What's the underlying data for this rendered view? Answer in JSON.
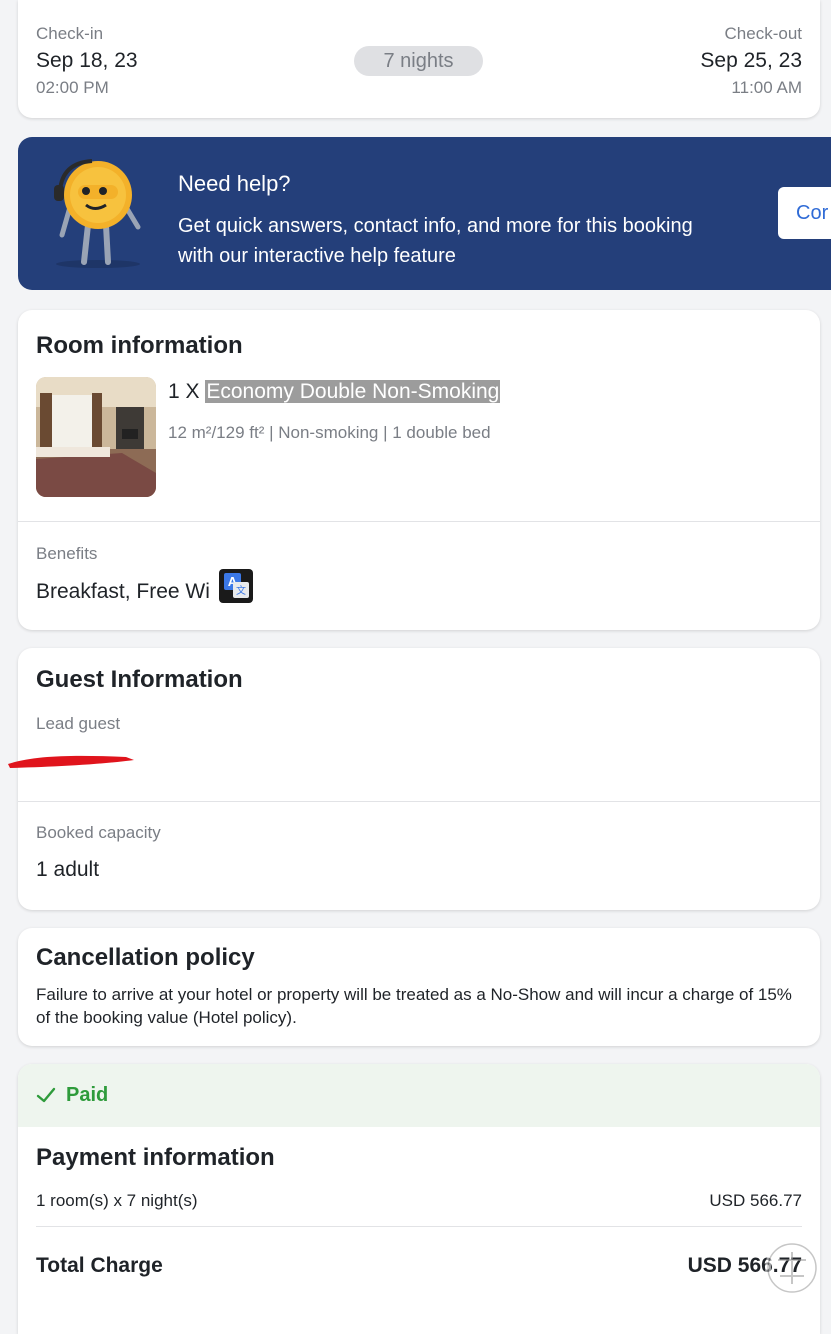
{
  "stay": {
    "checkin_label": "Check-in",
    "checkin_date": "Sep 18, 23",
    "checkin_time": "02:00 PM",
    "nights": "7 nights",
    "checkout_label": "Check-out",
    "checkout_date": "Sep 25, 23",
    "checkout_time": "11:00 AM"
  },
  "help": {
    "title": "Need help?",
    "text": "Get quick answers, contact info, and more for this booking with our interactive help feature",
    "button": "Cor"
  },
  "room": {
    "section_title": "Room information",
    "qty": "1 X",
    "name": "Economy Double Non-Smoking",
    "meta": "12 m²/129 ft² | Non-smoking | 1 double bed",
    "benefits_label": "Benefits",
    "benefits_value": "Breakfast, Free Wi"
  },
  "guest": {
    "section_title": "Guest Information",
    "lead_label": "Lead guest",
    "capacity_label": "Booked capacity",
    "capacity_value": "1 adult"
  },
  "cancellation": {
    "title": "Cancellation policy",
    "text": "Failure to arrive at your hotel or property will be treated as a No-Show and will incur a charge of 15% of the booking value (Hotel policy)."
  },
  "payment": {
    "status": "Paid",
    "title": "Payment information",
    "line_label": "1 room(s) x 7 night(s)",
    "line_amount": "USD 566.77",
    "total_label": "Total Charge",
    "total_amount": "USD 566.77"
  },
  "colors": {
    "banner": "#243f7a",
    "paid_green": "#2e9b3b",
    "accent_blue": "#2f6bd6",
    "redaction": "#e0141c"
  }
}
